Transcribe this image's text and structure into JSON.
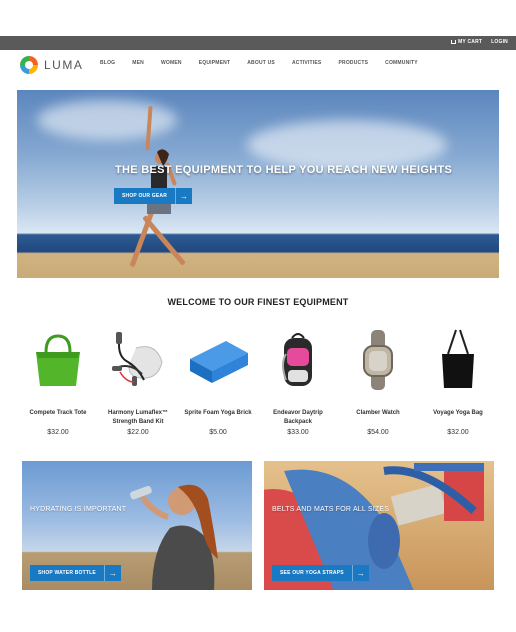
{
  "topbar": {
    "cart_label": "MY CART",
    "login_label": "LOGIN"
  },
  "header": {
    "logo_text": "LUMA",
    "nav": [
      "BLOG",
      "MEN",
      "WOMEN",
      "EQUIPMENT",
      "ABOUT US",
      "ACTIVITIES",
      "PRODUCTS",
      "COMMUNITY"
    ]
  },
  "hero": {
    "title": "THE BEST EQUIPMENT TO HELP YOU REACH NEW HEIGHTS",
    "button_label": "SHOP OUR GEAR",
    "button_arrow": "→"
  },
  "section": {
    "title": "WELCOME TO OUR FINEST EQUIPMENT"
  },
  "products": [
    {
      "name": "Compete Track Tote",
      "price": "$32.00",
      "icon": "green-tote-bag-icon"
    },
    {
      "name": "Harmony Lumaflex™ Strength Band Kit",
      "price": "$22.00",
      "icon": "resistance-band-icon"
    },
    {
      "name": "Sprite Foam Yoga Brick",
      "price": "$5.00",
      "icon": "blue-yoga-brick-icon"
    },
    {
      "name": "Endeavor Daytrip Backpack",
      "price": "$33.00",
      "icon": "backpack-icon"
    },
    {
      "name": "Clamber Watch",
      "price": "$54.00",
      "icon": "watch-icon"
    },
    {
      "name": "Voyage Yoga Bag",
      "price": "$32.00",
      "icon": "black-yoga-bag-icon"
    }
  ],
  "promos": {
    "left": {
      "text": "HYDRATING IS IMPORTANT",
      "button_label": "SHOP WATER BOTTLE",
      "button_arrow": "→"
    },
    "right": {
      "text": "BELTS AND MATS FOR ALL SIZES",
      "button_label": "SEE OUR YOGA STRAPS",
      "button_arrow": "→"
    }
  },
  "colors": {
    "accent": "#1979c3",
    "topbar": "#5a5a5a"
  }
}
